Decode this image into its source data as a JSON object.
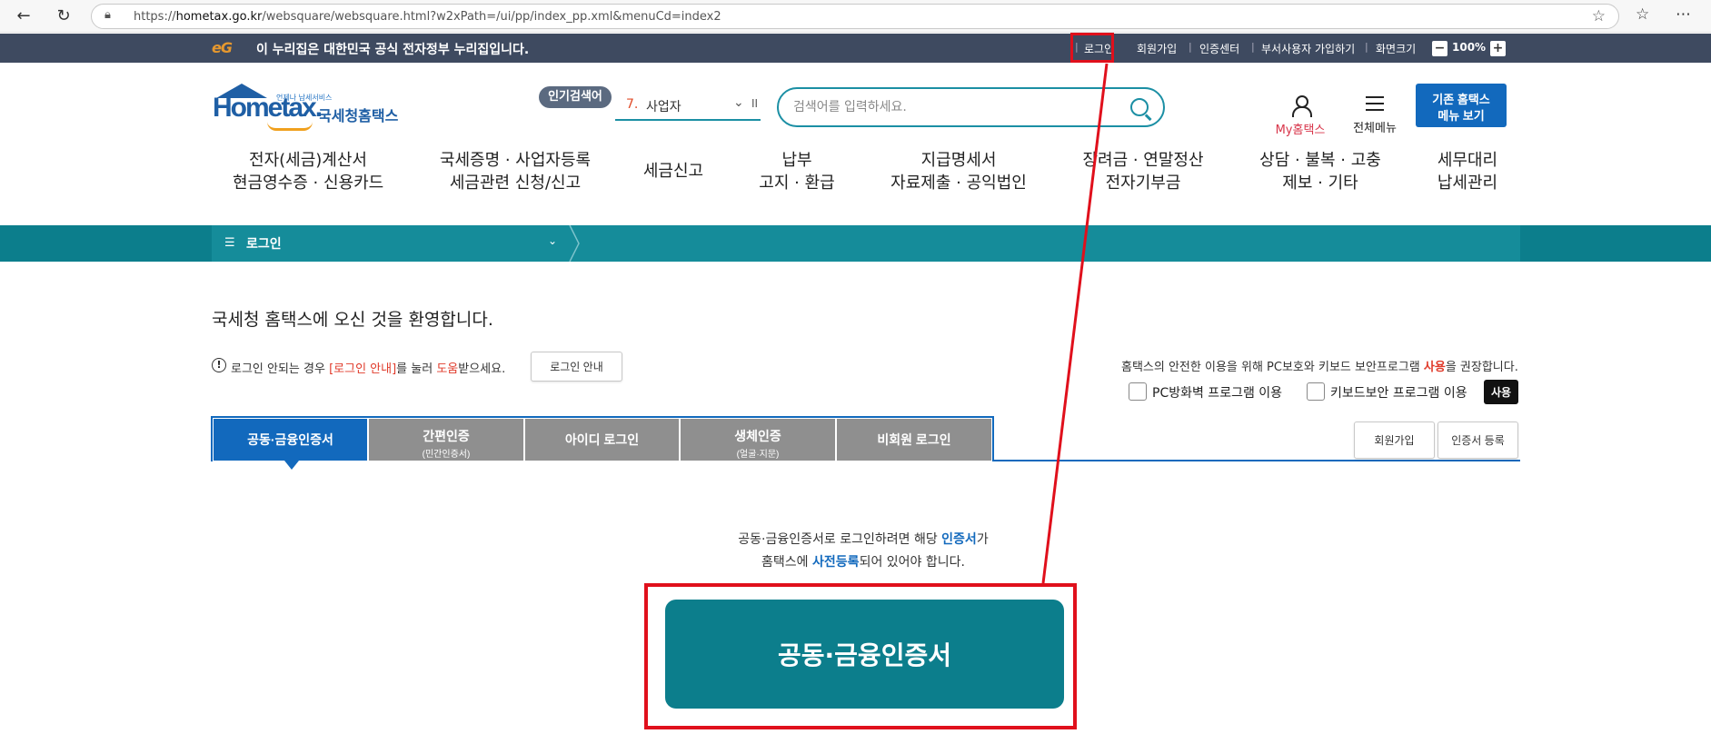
{
  "browser": {
    "url_prefix": "https://",
    "url_host": "hometax.go.kr",
    "url_path": "/websquare/websquare.html?w2xPath=/ui/pp/index_pp.xml&menuCd=index2"
  },
  "gov_bar": {
    "logo": "eG",
    "text": "이 누리집은 대한민국 공식 전자정부 누리집입니다.",
    "login": "로그인",
    "join": "회원가입",
    "cert_center": "인증센터",
    "dept_join": "부서사용자 가입하기",
    "screen_size": "화면크기",
    "zoom": "100%"
  },
  "header": {
    "logo_small": "언제나 납세서비스",
    "logo_main": "Hometax.",
    "logo_kr": "국세청홈택스",
    "popular_label": "인기검색어",
    "rank_num": "7.",
    "rank_word": "사업자",
    "search_placeholder": "검색어를 입력하세요.",
    "my_hometax": "My홈택스",
    "all_menu": "전체메뉴",
    "old_menu_line1": "기존 홈택스",
    "old_menu_line2": "메뉴 보기"
  },
  "gnb": [
    {
      "line1": "전자(세금)계산서",
      "line2": "현금영수증 · 신용카드"
    },
    {
      "line1": "국세증명 · 사업자등록",
      "line2": "세금관련 신청/신고"
    },
    {
      "line1": "세금신고",
      "line2": ""
    },
    {
      "line1": "납부",
      "line2": "고지 · 환급"
    },
    {
      "line1": "지급명세서",
      "line2": "자료제출 · 공익법인"
    },
    {
      "line1": "장려금 · 연말정산",
      "line2": "전자기부금"
    },
    {
      "line1": "상담 · 불복 · 고충",
      "line2": "제보 · 기타"
    },
    {
      "line1": "세무대리",
      "line2": "납세관리"
    }
  ],
  "location": {
    "title": "로그인"
  },
  "content": {
    "welcome": "국세청 홈택스에 오신 것을 환영합니다.",
    "notice_pre": "로그인 안되는 경우 ",
    "notice_link": "[로그인 안내]",
    "notice_mid": "를 눌러 ",
    "notice_help": "도움",
    "notice_post": "받으세요.",
    "login_guide_btn": "로그인 안내",
    "security_pre": "홈택스의 안전한 이용을 위해 PC보호와 키보드 보안프로그램 ",
    "security_use": "사용",
    "security_post": "을 권장합니다.",
    "pc_firewall": "PC방화벽 프로그램 이용",
    "keyboard_security": "키보드보안 프로그램 이용",
    "use_btn": "사용"
  },
  "tabs": [
    {
      "label": "공동·금융인증서",
      "sub": ""
    },
    {
      "label": "간편인증",
      "sub": "(민간인증서)"
    },
    {
      "label": "아이디 로그인",
      "sub": ""
    },
    {
      "label": "생체인증",
      "sub": "(얼굴·지문)"
    },
    {
      "label": "비회원 로그인",
      "sub": ""
    }
  ],
  "right_buttons": {
    "join": "회원가입",
    "cert_register": "인증서 등록"
  },
  "cert": {
    "info_pre": "공동·금융인증서로 로그인하려면 해당 ",
    "info_cert": "인증서",
    "info_mid": "가",
    "info_line2_pre": "홈택스에 ",
    "info_prereg": "사전등록",
    "info_line2_post": "되어 있어야 합니다.",
    "button": "공동·금융인증서"
  },
  "colors": {
    "teal": "#0c7e8c",
    "blue": "#1269bd",
    "highlight_red": "#e0101c",
    "gov_bar": "#3e4a60"
  }
}
